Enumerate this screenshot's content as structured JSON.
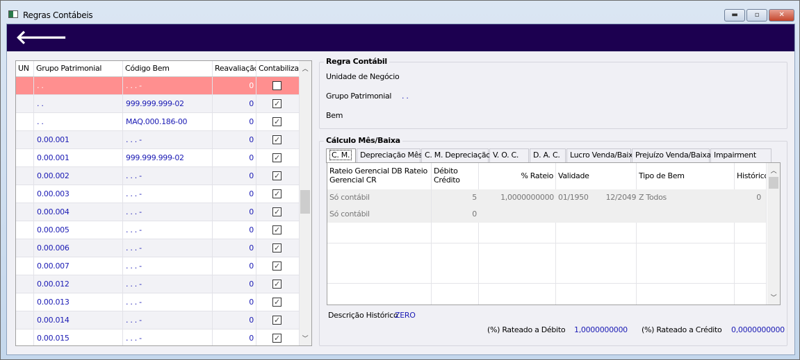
{
  "window": {
    "title": "Regras Contábeis",
    "minimize": "▬",
    "maximize": "▫",
    "close": "✕"
  },
  "toolbar": {
    "back_icon": "arrow-left-icon",
    "back": "🡐"
  },
  "left_grid": {
    "columns": [
      "UN",
      "Grupo Patrimonial",
      "Código Bem",
      "Reavaliação",
      "Contabilizar"
    ],
    "rows": [
      {
        "un": "",
        "grupo": ". .",
        "codigo": ". .  . -",
        "reav": "0",
        "contab": false,
        "selected": true
      },
      {
        "un": "",
        "grupo": ". .",
        "codigo": "999.999.999-02",
        "reav": "0",
        "contab": true
      },
      {
        "un": "",
        "grupo": ". .",
        "codigo": "MAQ.000.186-00",
        "reav": "0",
        "contab": true
      },
      {
        "un": "",
        "grupo": "0.00.001",
        "codigo": ". .  . -",
        "reav": "0",
        "contab": true
      },
      {
        "un": "",
        "grupo": "0.00.001",
        "codigo": "999.999.999-02",
        "reav": "0",
        "contab": true
      },
      {
        "un": "",
        "grupo": "0.00.002",
        "codigo": ". .  . -",
        "reav": "0",
        "contab": true
      },
      {
        "un": "",
        "grupo": "0.00.003",
        "codigo": ". .  . -",
        "reav": "0",
        "contab": true
      },
      {
        "un": "",
        "grupo": "0.00.004",
        "codigo": ". .  . -",
        "reav": "0",
        "contab": true
      },
      {
        "un": "",
        "grupo": "0.00.005",
        "codigo": ". .  . -",
        "reav": "0",
        "contab": true
      },
      {
        "un": "",
        "grupo": "0.00.006",
        "codigo": ". .  . -",
        "reav": "0",
        "contab": true
      },
      {
        "un": "",
        "grupo": "0.00.007",
        "codigo": ". .  . -",
        "reav": "0",
        "contab": true
      },
      {
        "un": "",
        "grupo": "0.00.012",
        "codigo": ". .  . -",
        "reav": "0",
        "contab": true
      },
      {
        "un": "",
        "grupo": "0.00.013",
        "codigo": ". .  . -",
        "reav": "0",
        "contab": true
      },
      {
        "un": "",
        "grupo": "0.00.014",
        "codigo": ". .  . -",
        "reav": "0",
        "contab": true
      },
      {
        "un": "",
        "grupo": "0.00.015",
        "codigo": ". .  . -",
        "reav": "0",
        "contab": true
      }
    ]
  },
  "regra": {
    "title": "Regra Contábil",
    "unidade_label": "Unidade de Negócio",
    "grupo_label": "Grupo Patrimonial",
    "grupo_value": ". .",
    "bem_label": "Bem"
  },
  "calculo": {
    "title": "Cálculo Mês/Baixa",
    "tabs": [
      "C. M.",
      "Depreciação Mês",
      "C. M. Depreciação",
      "V. O. C.",
      "D. A. C.",
      "Lucro Venda/Baixa",
      "Prejuízo Venda/Baixa",
      "Impairment"
    ],
    "active_tab": "C. M.",
    "columns": [
      "Rateio Gerencial DB Rateio Gerencial CR",
      "Débito Crédito",
      "% Rateio",
      "Validade",
      "Tipo de Bem",
      "Histórico"
    ],
    "rows": [
      {
        "rateio": "Só contábil",
        "debcred": "5",
        "pct": "1,0000000000",
        "val_de": "01/1950",
        "val_ate": "12/2049",
        "tipo": "Z Todos",
        "hist": "0"
      },
      {
        "rateio": "Só contábil",
        "debcred": "0",
        "pct": "",
        "val_de": "",
        "val_ate": "",
        "tipo": "",
        "hist": ""
      }
    ],
    "descricao_label": "Descrição Histórico",
    "descricao_value": "ZERO",
    "debito_label": "(%) Rateado a Débito",
    "debito_value": "1,0000000000",
    "credito_label": "(%) Rateado a Crédito",
    "credito_value": "0,0000000000"
  }
}
